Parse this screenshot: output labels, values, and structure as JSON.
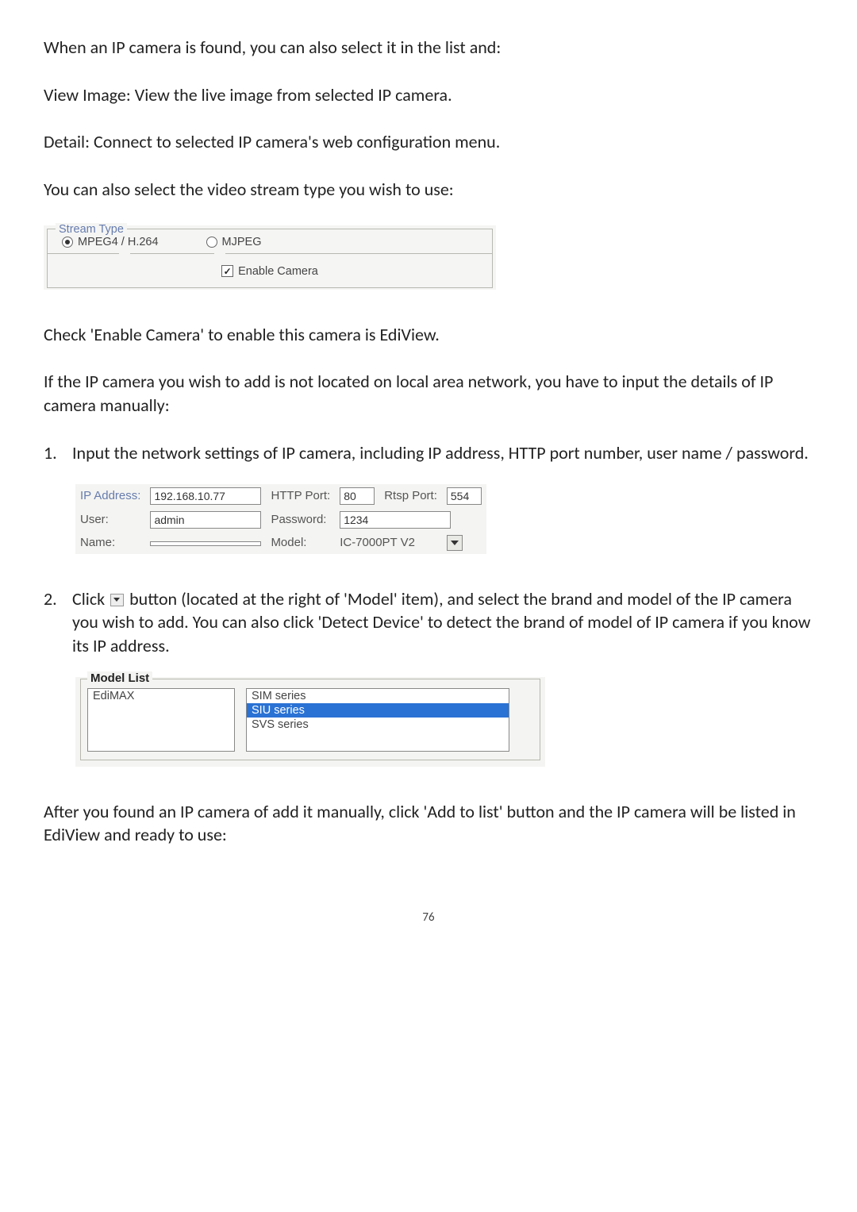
{
  "intro": {
    "line1": "When an IP camera is found, you can also select it in the list and:",
    "line2": "View Image: View the live image from selected IP camera.",
    "line3": "Detail: Connect to selected IP camera's web configuration menu.",
    "line4": "You can also select the video stream type you wish to use:"
  },
  "stream": {
    "legend": "Stream Type",
    "opt1": "MPEG4 / H.264",
    "opt2": "MJPEG",
    "enable": "Enable Camera"
  },
  "mid": {
    "check": "Check 'Enable Camera' to enable this camera is EdiView.",
    "manual": "If the IP camera you wish to add is not located on local area network, you have to input the details of IP camera manually:"
  },
  "step1": {
    "num": "1.",
    "text": "Input the network settings of IP camera, including IP address, HTTP port number, user name / password."
  },
  "settings": {
    "ipaddr_label": "IP Address:",
    "ipaddr": "192.168.10.77",
    "httpport_label": "HTTP Port:",
    "httpport": "80",
    "rtspport_label": "Rtsp Port:",
    "rtspport": "554",
    "user_label": "User:",
    "user": "admin",
    "password_label": "Password:",
    "password": "1234",
    "name_label": "Name:",
    "name": "",
    "model_label": "Model:",
    "model": "IC-7000PT V2"
  },
  "step2": {
    "num": "2.",
    "t_before": "Click ",
    "t_after": " button (located at the right of 'Model' item), and select the brand and model of the IP camera you wish to add. You can also click 'Detect Device' to detect the brand of model of IP camera if you know its IP address."
  },
  "modellist": {
    "legend": "Model List",
    "brand": "EdiMAX",
    "series": [
      "SIM series",
      "SIU series",
      "SVS series"
    ],
    "selected_index": 1
  },
  "outro": "After you found an IP camera of add it manually, click 'Add to list' button and the IP camera will be listed in EdiView and ready to use:",
  "page": "76"
}
